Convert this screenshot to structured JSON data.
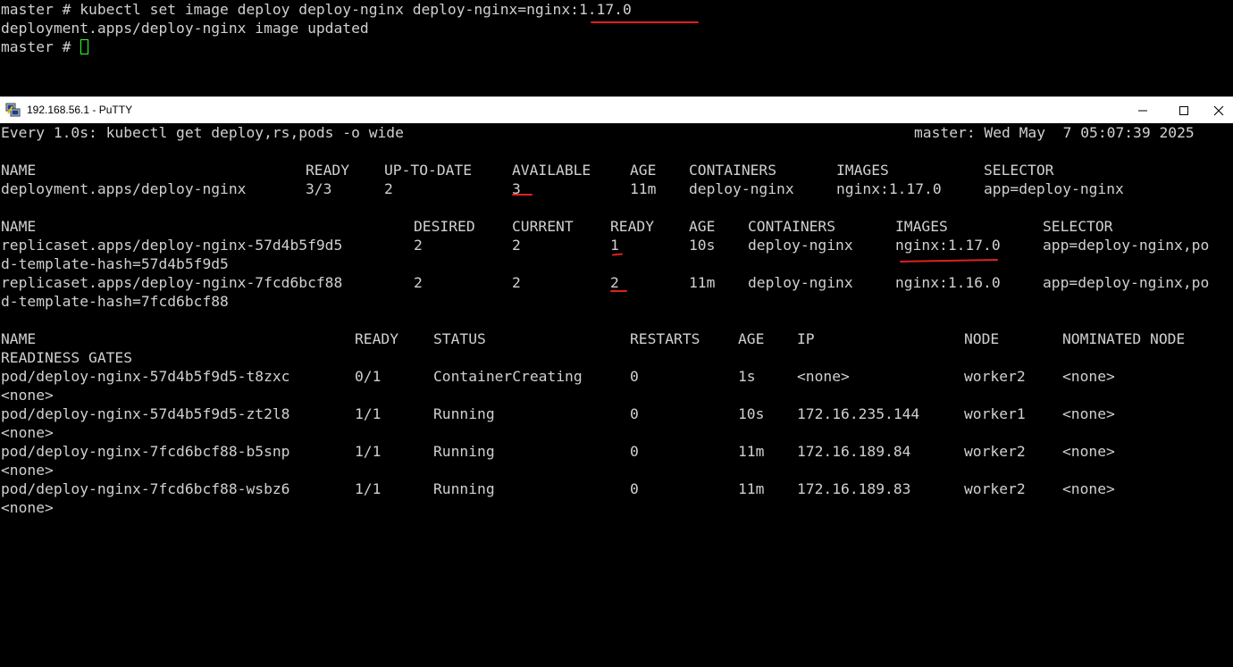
{
  "top_terminal": {
    "lines": [
      "master # kubectl set image deploy deploy-nginx deploy-nginx=nginx:1.17.0",
      "deployment.apps/deploy-nginx image updated"
    ],
    "prompt": "master # "
  },
  "window": {
    "title": "192.168.56.1 - PuTTY",
    "icon": "putty-icon",
    "controls": [
      "minimize-icon",
      "maximize-icon",
      "close-icon"
    ]
  },
  "watch": {
    "header_left": "Every 1.0s: kubectl get deploy,rs,pods -o wide",
    "header_right": "master: Wed May  7 05:07:39 2025"
  },
  "deployments": {
    "headers": [
      "NAME",
      "READY",
      "UP-TO-DATE",
      "AVAILABLE",
      "AGE",
      "CONTAINERS",
      "IMAGES",
      "SELECTOR"
    ],
    "rows": [
      [
        "deployment.apps/deploy-nginx",
        "3/3",
        "2",
        "3",
        "11m",
        "deploy-nginx",
        "nginx:1.17.0",
        "app=deploy-nginx"
      ]
    ]
  },
  "replicasets": {
    "headers": [
      "NAME",
      "DESIRED",
      "CURRENT",
      "READY",
      "AGE",
      "CONTAINERS",
      "IMAGES",
      "SELECTOR"
    ],
    "rows": [
      {
        "cells": [
          "replicaset.apps/deploy-nginx-57d4b5f9d5",
          "2",
          "2",
          "1",
          "10s",
          "deploy-nginx",
          "nginx:1.17.0",
          "app=deploy-nginx,po"
        ],
        "wrap": "d-template-hash=57d4b5f9d5"
      },
      {
        "cells": [
          "replicaset.apps/deploy-nginx-7fcd6bcf88",
          "2",
          "2",
          "2",
          "11m",
          "deploy-nginx",
          "nginx:1.16.0",
          "app=deploy-nginx,po"
        ],
        "wrap": "d-template-hash=7fcd6bcf88"
      }
    ]
  },
  "pods": {
    "headers": [
      "NAME",
      "READY",
      "STATUS",
      "RESTARTS",
      "AGE",
      "IP",
      "NODE",
      "NOMINATED NODE"
    ],
    "header_wrap": "READINESS GATES",
    "rows": [
      {
        "cells": [
          "pod/deploy-nginx-57d4b5f9d5-t8zxc",
          "0/1",
          "ContainerCreating",
          "0",
          "1s",
          "<none>",
          "worker2",
          "<none>"
        ],
        "wrap": "<none>"
      },
      {
        "cells": [
          "pod/deploy-nginx-57d4b5f9d5-zt2l8",
          "1/1",
          "Running",
          "0",
          "10s",
          "172.16.235.144",
          "worker1",
          "<none>"
        ],
        "wrap": "<none>"
      },
      {
        "cells": [
          "pod/deploy-nginx-7fcd6bcf88-b5snp",
          "1/1",
          "Running",
          "0",
          "11m",
          "172.16.189.84",
          "worker2",
          "<none>"
        ],
        "wrap": "<none>"
      },
      {
        "cells": [
          "pod/deploy-nginx-7fcd6bcf88-wsbz6",
          "1/1",
          "Running",
          "0",
          "11m",
          "172.16.189.83",
          "worker2",
          "<none>"
        ],
        "wrap": "<none>"
      }
    ]
  },
  "colors": {
    "terminal_bg": "#000000",
    "terminal_fg": "#d0d0d0",
    "cursor": "#32ff32",
    "annotation": "#e02020"
  }
}
